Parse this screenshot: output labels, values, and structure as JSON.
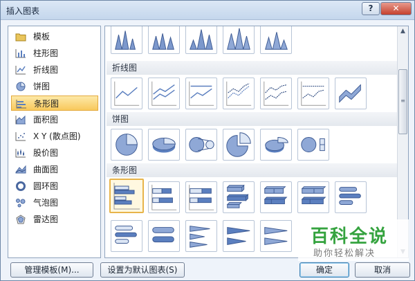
{
  "window": {
    "title": "插入图表",
    "help_glyph": "?",
    "close_glyph": "✕"
  },
  "sidebar": {
    "items": [
      {
        "label": "模板",
        "icon": "folder-icon",
        "selected": false
      },
      {
        "label": "柱形图",
        "icon": "column-chart-icon",
        "selected": false
      },
      {
        "label": "折线图",
        "icon": "line-chart-icon",
        "selected": false
      },
      {
        "label": "饼图",
        "icon": "pie-chart-icon",
        "selected": false
      },
      {
        "label": "条形图",
        "icon": "bar-chart-icon",
        "selected": true
      },
      {
        "label": "面积图",
        "icon": "area-chart-icon",
        "selected": false
      },
      {
        "label": "X Y (散点图)",
        "icon": "scatter-chart-icon",
        "selected": false
      },
      {
        "label": "股价图",
        "icon": "stock-chart-icon",
        "selected": false
      },
      {
        "label": "曲面图",
        "icon": "surface-chart-icon",
        "selected": false
      },
      {
        "label": "圆环图",
        "icon": "doughnut-chart-icon",
        "selected": false
      },
      {
        "label": "气泡图",
        "icon": "bubble-chart-icon",
        "selected": false
      },
      {
        "label": "雷达图",
        "icon": "radar-chart-icon",
        "selected": false
      }
    ]
  },
  "gallery": {
    "sections": [
      {
        "title": "折线图"
      },
      {
        "title": "饼图"
      },
      {
        "title": "条形图"
      }
    ]
  },
  "colors": {
    "accent_selected": "#f8c95c",
    "chart_blue": "#5b7fbf",
    "watermark_green": "#35a33f"
  },
  "buttons": {
    "manage_templates": "管理模板(M)...",
    "set_default": "设置为默认图表(S)",
    "ok": "确定",
    "cancel": "取消"
  },
  "watermark": {
    "title": "百科全说",
    "subtitle": "助你轻松解决"
  }
}
